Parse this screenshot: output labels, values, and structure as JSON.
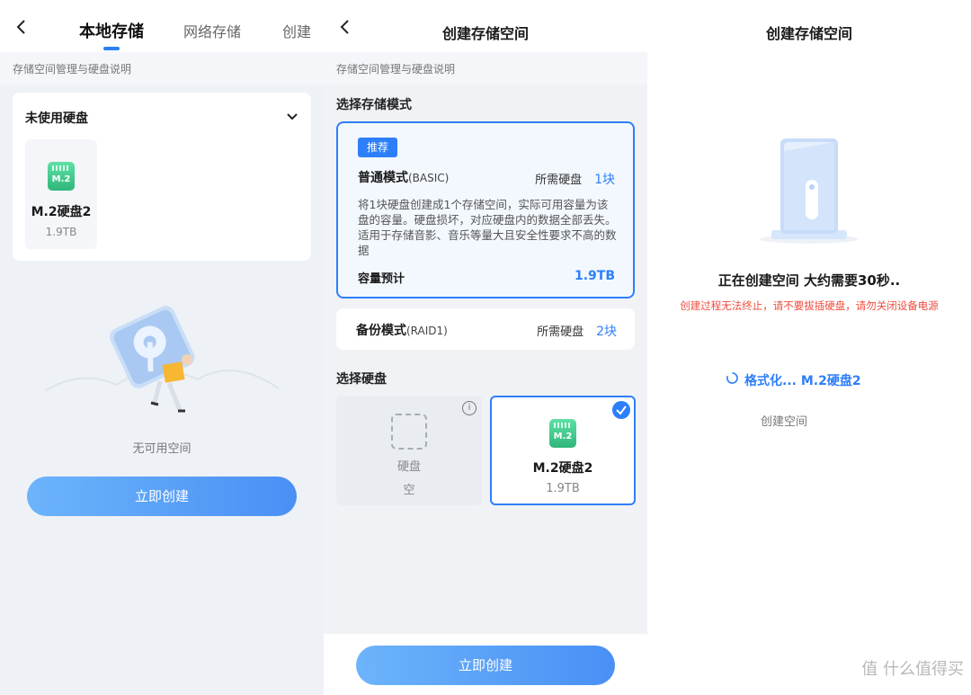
{
  "screen1": {
    "tabs": [
      "本地存储",
      "网络存储",
      "创建"
    ],
    "subtitle": "存储空间管理与硬盘说明",
    "unused_title": "未使用硬盘",
    "disk": {
      "icon_label": "M.2",
      "name": "M.2硬盘2",
      "size": "1.9TB"
    },
    "empty_text": "无可用空间",
    "create_button": "立即创建"
  },
  "screen2": {
    "title": "创建存储空间",
    "subtitle": "存储空间管理与硬盘说明",
    "mode_section": "选择存储模式",
    "recommend_badge": "推荐",
    "basic": {
      "name": "普通模式",
      "tag": "(BASIC)",
      "req_label": "所需硬盘",
      "req_value": "1块",
      "desc": "将1块硬盘创建成1个存储空间，实际可用容量为该盘的容量。硬盘损坏，对应硬盘内的数据全部丢失。适用于存储音影、音乐等量大且安全性要求不高的数据",
      "cap_label": "容量预计",
      "cap_value": "1.9TB"
    },
    "raid1": {
      "name": "备份模式",
      "tag": "(RAID1)",
      "req_label": "所需硬盘",
      "req_value": "2块"
    },
    "disk_section": "选择硬盘",
    "slot_empty": {
      "name": "硬盘",
      "status": "空"
    },
    "slot_selected": {
      "icon_label": "M.2",
      "name": "M.2硬盘2",
      "size": "1.9TB"
    },
    "create_button": "立即创建"
  },
  "screen3": {
    "title": "创建存储空间",
    "main_text": "正在创建空间 大约需要30秒..",
    "warning": "创建过程无法终止，请不要拔插硬盘，请勿关闭设备电源",
    "formatting": "格式化...  M.2硬盘2",
    "step": "创建空间",
    "watermark": "值 什么值得买"
  },
  "colors": {
    "accent": "#2d7ff9",
    "warning": "#ef4b3d",
    "disk_green": "#2fb67a"
  }
}
